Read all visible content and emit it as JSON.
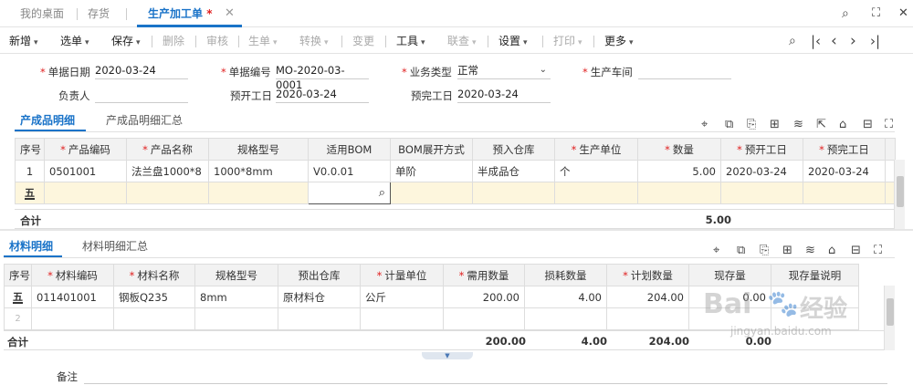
{
  "tabs": {
    "home": "我的桌面",
    "stock": "存货",
    "active": "生产加工单",
    "modified_mark": "*"
  },
  "toolbar": {
    "new": "新增",
    "select_order": "选单",
    "save": "保存",
    "delete": "删除",
    "audit": "审核",
    "generate": "生单",
    "convert": "转换",
    "change": "变更",
    "tools": "工具",
    "link_query": "联查",
    "settings": "设置",
    "print": "打印",
    "more": "更多"
  },
  "form": {
    "doc_date_label": "单据日期",
    "doc_date": "2020-03-24",
    "doc_no_label": "单据编号",
    "doc_no": "MO-2020-03-0001",
    "biz_type_label": "业务类型",
    "biz_type": "正常",
    "workshop_label": "生产车间",
    "workshop": "",
    "owner_label": "负责人",
    "owner": "",
    "plan_start_label": "预开工日",
    "plan_start": "2020-03-24",
    "plan_end_label": "预完工日",
    "plan_end": "2020-03-24",
    "remark_label": "备注"
  },
  "product": {
    "tab_detail": "产成品明细",
    "tab_summary": "产成品明细汇总",
    "headers": [
      "序号",
      "产品编码",
      "产品名称",
      "规格型号",
      "适用BOM",
      "BOM展开方式",
      "预入仓库",
      "生产单位",
      "数量",
      "预开工日",
      "预完工日"
    ],
    "required": [
      false,
      true,
      true,
      false,
      false,
      false,
      false,
      true,
      true,
      true,
      true
    ],
    "rows": [
      [
        "1",
        "0501001",
        "法兰盘1000*8",
        "1000*8mm",
        "V0.0.01",
        "单阶",
        "半成品仓",
        "个",
        "5.00",
        "2020-03-24",
        "2020-03-24"
      ]
    ],
    "total_label": "合计",
    "total_qty": "5.00"
  },
  "material": {
    "tab_detail": "材料明细",
    "tab_summary": "材料明细汇总",
    "headers": [
      "序号",
      "材料编码",
      "材料名称",
      "规格型号",
      "预出仓库",
      "计量单位",
      "需用数量",
      "损耗数量",
      "计划数量",
      "现存量",
      "现存量说明"
    ],
    "required": [
      false,
      true,
      true,
      false,
      false,
      true,
      true,
      false,
      true,
      false,
      false
    ],
    "rows": [
      [
        "",
        "011401001",
        "钢板Q235",
        "8mm",
        "原材料仓",
        "公斤",
        "200.00",
        "4.00",
        "204.00",
        "0.00",
        ""
      ],
      [
        "2",
        "",
        "",
        "",
        "",
        "",
        "",
        "",
        "",
        "",
        ""
      ]
    ],
    "total_label": "合计",
    "total_need": "200.00",
    "total_loss": "4.00",
    "total_plan": "204.00",
    "total_stock": "0.00"
  },
  "watermark": {
    "brand": "Bai",
    "brand2": "经验",
    "url": "jingyan.baidu.com"
  }
}
